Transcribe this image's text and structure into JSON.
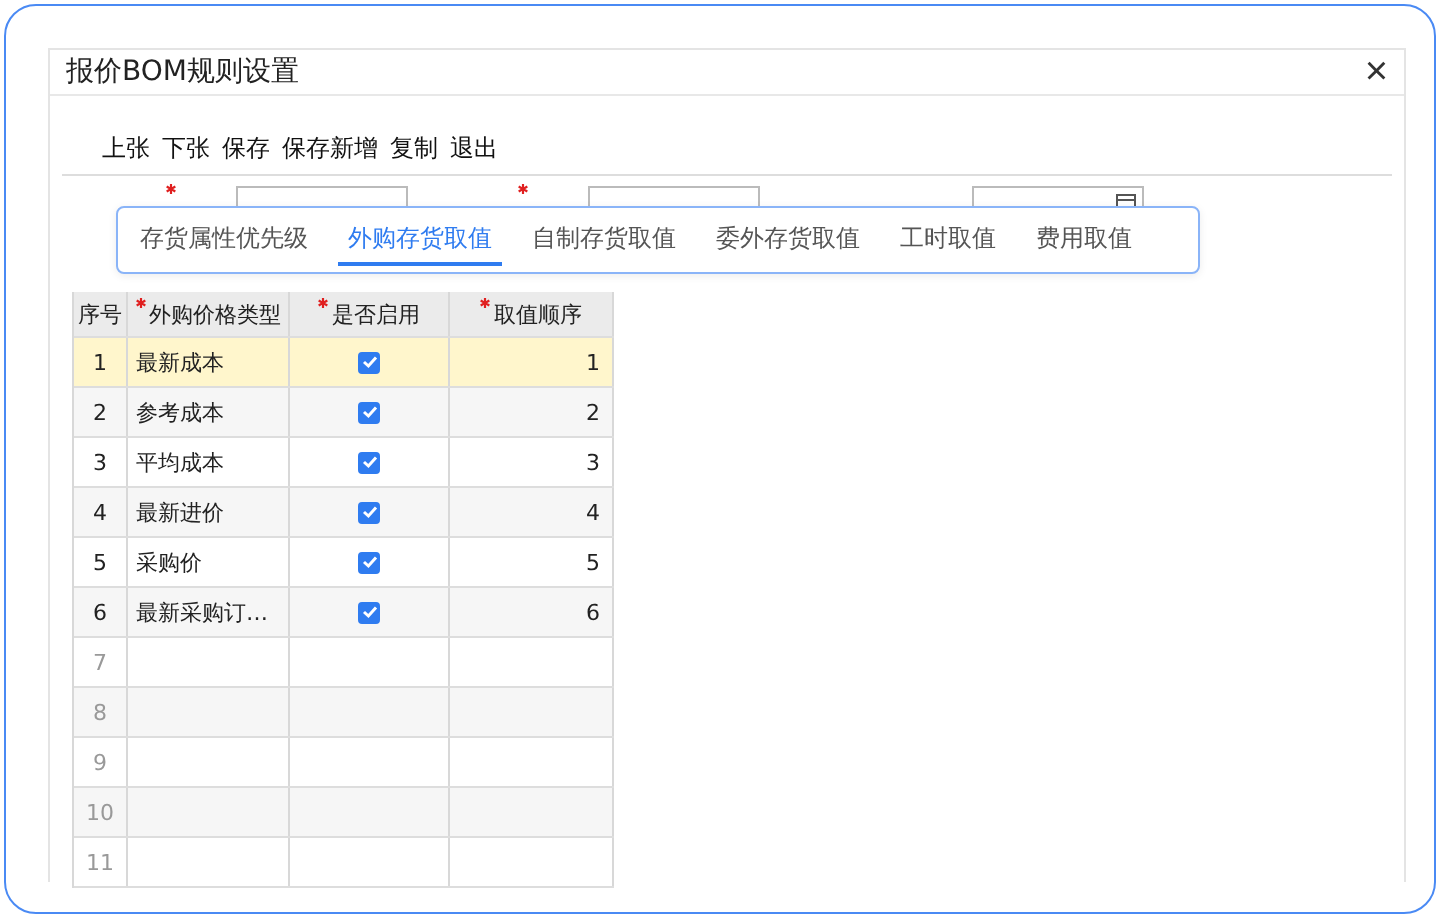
{
  "dialog": {
    "title": "报价BOM规则设置",
    "close": "×"
  },
  "toolbar": [
    "上张",
    "下张",
    "保存",
    "保存新增",
    "复制",
    "退出"
  ],
  "fields": [
    {
      "required": true
    },
    {
      "required": true
    },
    {
      "required": false
    }
  ],
  "popup_tabs": [
    {
      "label": "存货属性优先级",
      "selected": false
    },
    {
      "label": "外购存货取值",
      "selected": true
    },
    {
      "label": "自制存货取值",
      "selected": false
    },
    {
      "label": "委外存货取值",
      "selected": false
    },
    {
      "label": "工时取值",
      "selected": false
    },
    {
      "label": "费用取值",
      "selected": false
    }
  ],
  "table": {
    "columns": [
      {
        "label": "序号",
        "required": false
      },
      {
        "label": "外购价格类型",
        "required": true
      },
      {
        "label": "是否启用",
        "required": true
      },
      {
        "label": "取值顺序",
        "required": true
      }
    ],
    "rows": [
      {
        "index": "1",
        "type": "最新成本",
        "enabled": true,
        "order": "1",
        "selected": true
      },
      {
        "index": "2",
        "type": "参考成本",
        "enabled": true,
        "order": "2",
        "selected": false
      },
      {
        "index": "3",
        "type": "平均成本",
        "enabled": true,
        "order": "3",
        "selected": false
      },
      {
        "index": "4",
        "type": "最新进价",
        "enabled": true,
        "order": "4",
        "selected": false
      },
      {
        "index": "5",
        "type": "采购价",
        "enabled": true,
        "order": "5",
        "selected": false
      },
      {
        "index": "6",
        "type": "最新采购订…",
        "enabled": true,
        "order": "6",
        "selected": false
      },
      {
        "index": "7",
        "kind": "empty"
      },
      {
        "index": "8",
        "kind": "empty"
      },
      {
        "index": "9",
        "kind": "empty"
      },
      {
        "index": "10",
        "kind": "empty"
      },
      {
        "index": "11",
        "kind": "empty"
      }
    ]
  }
}
